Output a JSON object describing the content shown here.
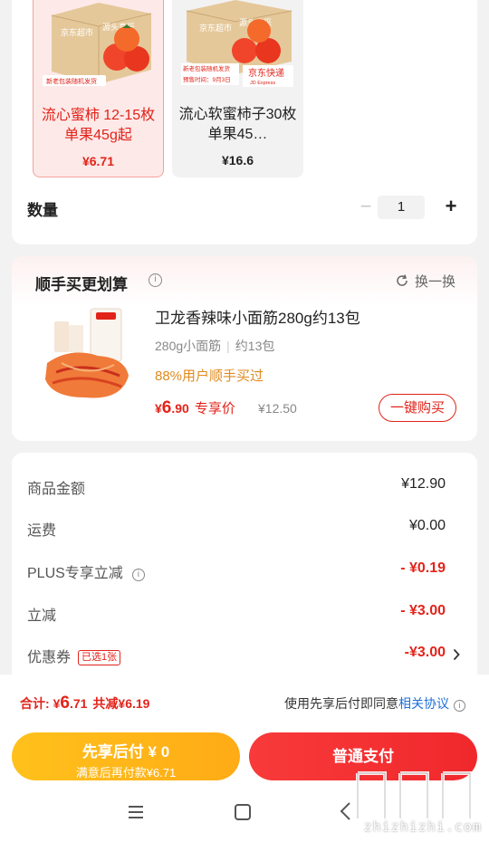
{
  "products": [
    {
      "name": "流心蜜柿 12-15枚 单果45g起",
      "price": "¥6.71",
      "selected": true,
      "box_brand": "京东超市",
      "box_slogan": "源头直采",
      "box_tag": "新老包装随机发货"
    },
    {
      "name": "流心软蜜柿子30枚 单果45…",
      "price": "¥16.6",
      "selected": false,
      "box_brand": "京东超市",
      "box_slogan": "源头直采",
      "box_tag": "新老包装随机发货",
      "presale": "预售时间：9月3日",
      "express": "京东快递",
      "express_en": "JD Express"
    }
  ],
  "quantity": {
    "label": "数量",
    "value": "1",
    "minus": "−",
    "plus": "+"
  },
  "recommend": {
    "title": "顺手买更划算",
    "info": "i",
    "refresh_label": "换一换",
    "item": {
      "name": "卫龙香辣味小面筋280g约13包",
      "spec_1": "280g小面筋",
      "spec_2": "约13包",
      "bought": "88%用户顺手买过",
      "price_symbol": "¥",
      "price_int": "6",
      "price_dec": ".90",
      "price_label": "专享价",
      "old_price": "¥12.50",
      "buy_label": "一键购买"
    }
  },
  "summary": {
    "rows": [
      {
        "key": "商品金额",
        "value": "¥12.90"
      },
      {
        "key": "运费",
        "value": "¥0.00"
      },
      {
        "key": "PLUS专享立减",
        "value": "- ¥0.19"
      },
      {
        "key": "立减",
        "value": "- ¥3.00"
      },
      {
        "key": "优惠券",
        "value": "-¥3.00",
        "badge": "已选1张"
      }
    ]
  },
  "bottom": {
    "total_label": "合计:",
    "total_symbol": "¥",
    "total_int": "6",
    "total_dec": ".71",
    "reduce_text": "共减¥6.19",
    "agree_prefix": "使用先享后付即同意",
    "agree_link": "相关协议",
    "later_main": "先享后付 ¥ 0",
    "later_sub": "满意后再付款¥6.71",
    "pay_label": "普通支付"
  },
  "watermark": {
    "text": "zhizhizhi.com",
    "glyph": "值值值"
  },
  "colors": {
    "accent": "#e2231a",
    "orange": "#ffb41a",
    "link": "#1f6fd9",
    "bought": "#e08a1e"
  }
}
